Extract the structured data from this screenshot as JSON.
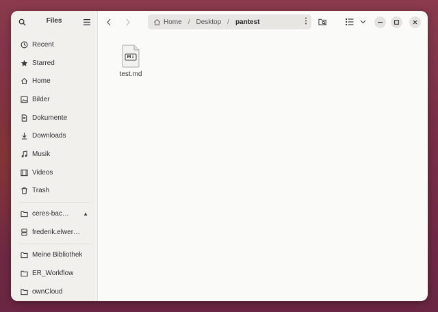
{
  "sidebar": {
    "title": "Files",
    "places": [
      {
        "label": "Recent",
        "icon": "clock-icon"
      },
      {
        "label": "Starred",
        "icon": "star-icon"
      },
      {
        "label": "Home",
        "icon": "home-icon"
      },
      {
        "label": "Bilder",
        "icon": "image-icon"
      },
      {
        "label": "Dokumente",
        "icon": "document-icon"
      },
      {
        "label": "Downloads",
        "icon": "download-icon"
      },
      {
        "label": "Musik",
        "icon": "music-icon"
      },
      {
        "label": "Videos",
        "icon": "video-icon"
      },
      {
        "label": "Trash",
        "icon": "trash-icon"
      }
    ],
    "devices": [
      {
        "label": "ceres-bac…",
        "icon": "folder-icon"
      },
      {
        "label": "frederik.elwer…",
        "icon": "server-icon"
      }
    ],
    "bookmarks": [
      {
        "label": "Meine Bibliothek",
        "icon": "folder-icon"
      },
      {
        "label": "ER_Workflow",
        "icon": "folder-icon"
      },
      {
        "label": "ownCloud",
        "icon": "folder-icon"
      }
    ]
  },
  "path": {
    "home": "Home",
    "segments": [
      "Desktop",
      "pantest"
    ],
    "separator": "/"
  },
  "files": [
    {
      "name": "test.md",
      "icon": "markdown-file-icon",
      "badge": "M↓"
    }
  ],
  "colors": {
    "window_bg": "#fafaf8",
    "sidebar_bg": "#f1f0ed",
    "desktop_bg": "#7a2e48"
  }
}
